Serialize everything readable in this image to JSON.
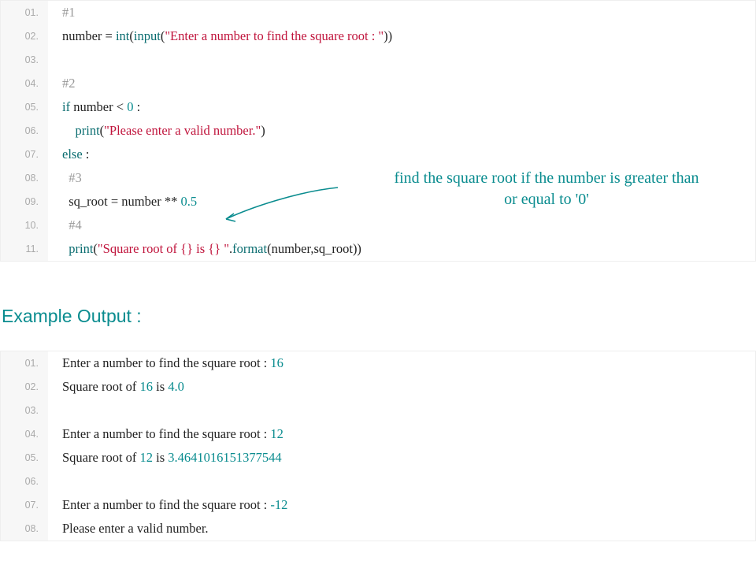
{
  "code_block_1": {
    "lines": [
      {
        "no": "01.",
        "tokens": [
          {
            "t": "#1",
            "cls": "tk-comment"
          }
        ]
      },
      {
        "no": "02.",
        "tokens": [
          {
            "t": "number = ",
            "cls": ""
          },
          {
            "t": "int",
            "cls": "tk-kw"
          },
          {
            "t": "(",
            "cls": ""
          },
          {
            "t": "input",
            "cls": "tk-kw"
          },
          {
            "t": "(",
            "cls": ""
          },
          {
            "t": "\"Enter a number to find the square root : \"",
            "cls": "tk-str"
          },
          {
            "t": "))",
            "cls": ""
          }
        ]
      },
      {
        "no": "03.",
        "tokens": []
      },
      {
        "no": "04.",
        "tokens": [
          {
            "t": "#2",
            "cls": "tk-comment"
          }
        ]
      },
      {
        "no": "05.",
        "tokens": [
          {
            "t": "if",
            "cls": "tk-kw"
          },
          {
            "t": " number < ",
            "cls": ""
          },
          {
            "t": "0",
            "cls": "tk-num"
          },
          {
            "t": " :",
            "cls": ""
          }
        ]
      },
      {
        "no": "06.",
        "tokens": [
          {
            "t": "    ",
            "cls": ""
          },
          {
            "t": "print",
            "cls": "tk-kw"
          },
          {
            "t": "(",
            "cls": ""
          },
          {
            "t": "\"Please enter a valid number.\"",
            "cls": "tk-str"
          },
          {
            "t": ")",
            "cls": ""
          }
        ]
      },
      {
        "no": "07.",
        "tokens": [
          {
            "t": "else",
            "cls": "tk-kw"
          },
          {
            "t": " :",
            "cls": ""
          }
        ]
      },
      {
        "no": "08.",
        "tokens": [
          {
            "t": "  ",
            "cls": ""
          },
          {
            "t": "#3",
            "cls": "tk-comment"
          }
        ]
      },
      {
        "no": "09.",
        "tokens": [
          {
            "t": "  sq_root = number ** ",
            "cls": ""
          },
          {
            "t": "0.5",
            "cls": "tk-num"
          }
        ]
      },
      {
        "no": "10.",
        "tokens": [
          {
            "t": "  ",
            "cls": ""
          },
          {
            "t": "#4",
            "cls": "tk-comment"
          }
        ]
      },
      {
        "no": "11.",
        "tokens": [
          {
            "t": "  ",
            "cls": ""
          },
          {
            "t": "print",
            "cls": "tk-kw"
          },
          {
            "t": "(",
            "cls": ""
          },
          {
            "t": "\"Square root of {} is {} \"",
            "cls": "tk-str"
          },
          {
            "t": ".",
            "cls": ""
          },
          {
            "t": "format",
            "cls": "tk-kw"
          },
          {
            "t": "(number,sq_root))",
            "cls": ""
          }
        ]
      }
    ]
  },
  "annotation": {
    "line1": "find the square root if the number is greater than",
    "line2": "or equal to '0'"
  },
  "heading": "Example Output :",
  "code_block_2": {
    "lines": [
      {
        "no": "01.",
        "tokens": [
          {
            "t": "Enter a number to find the square root : ",
            "cls": ""
          },
          {
            "t": "16",
            "cls": "tk-num"
          }
        ]
      },
      {
        "no": "02.",
        "tokens": [
          {
            "t": "Square root of ",
            "cls": ""
          },
          {
            "t": "16",
            "cls": "tk-num"
          },
          {
            "t": " is ",
            "cls": ""
          },
          {
            "t": "4.0",
            "cls": "tk-num"
          }
        ]
      },
      {
        "no": "03.",
        "tokens": []
      },
      {
        "no": "04.",
        "tokens": [
          {
            "t": "Enter a number to find the square root : ",
            "cls": ""
          },
          {
            "t": "12",
            "cls": "tk-num"
          }
        ]
      },
      {
        "no": "05.",
        "tokens": [
          {
            "t": "Square root of ",
            "cls": ""
          },
          {
            "t": "12",
            "cls": "tk-num"
          },
          {
            "t": " is ",
            "cls": ""
          },
          {
            "t": "3.4641016151377544",
            "cls": "tk-num"
          }
        ]
      },
      {
        "no": "06.",
        "tokens": []
      },
      {
        "no": "07.",
        "tokens": [
          {
            "t": "Enter a number to find the square root : ",
            "cls": ""
          },
          {
            "t": "-",
            "cls": "tk-num"
          },
          {
            "t": "12",
            "cls": "tk-num"
          }
        ]
      },
      {
        "no": "08.",
        "tokens": [
          {
            "t": "Please enter a valid number.",
            "cls": ""
          }
        ]
      }
    ]
  }
}
